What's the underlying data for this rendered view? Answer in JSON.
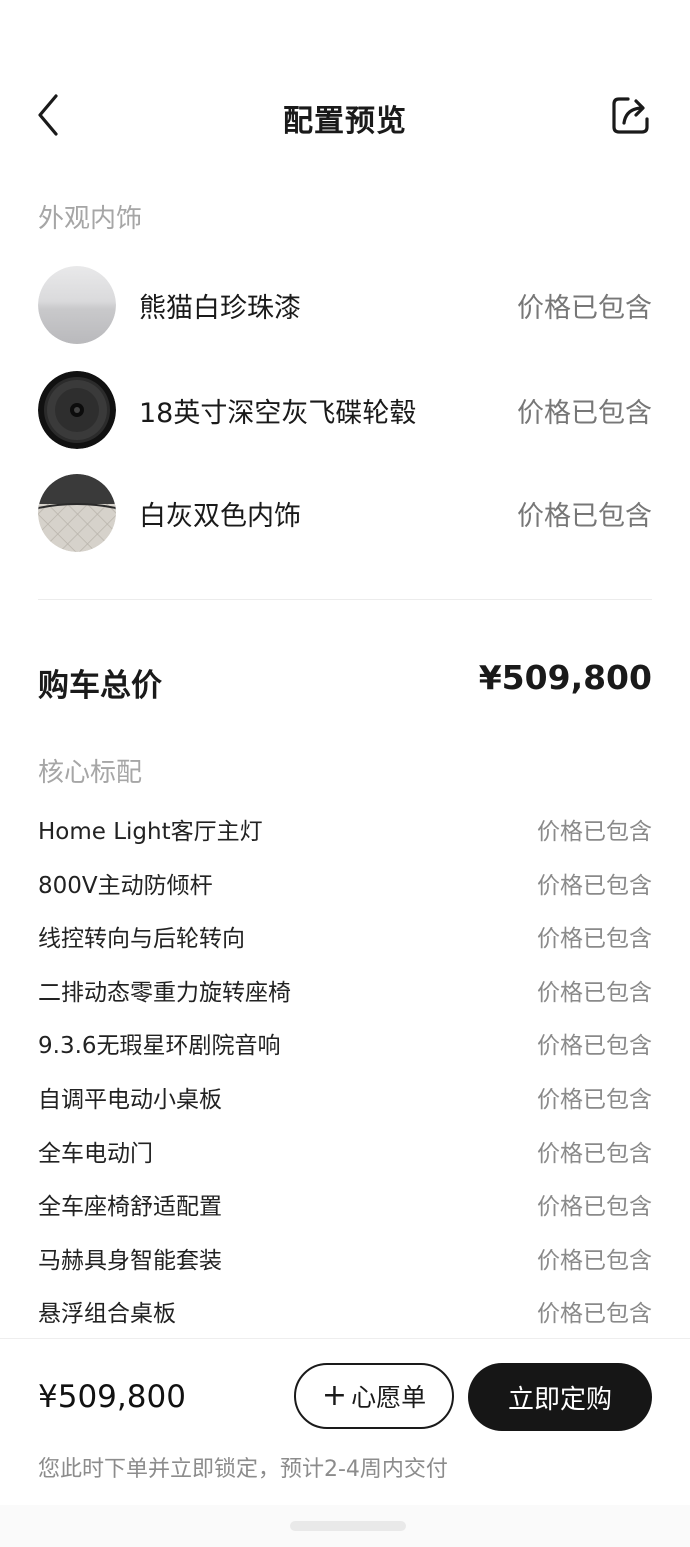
{
  "header": {
    "title": "配置预览",
    "back_icon": "chevron-left-icon",
    "share_icon": "share-icon"
  },
  "appearance": {
    "section_label": "外观内饰",
    "options": [
      {
        "name": "熊猫白珍珠漆",
        "price": "价格已包含",
        "swatch": "paint-swatch",
        "color": "#d4d4d6"
      },
      {
        "name": "18英寸深空灰飞碟轮毂",
        "price": "价格已包含",
        "swatch": "wheel-swatch",
        "color": "#1b1b1b"
      },
      {
        "name": "白灰双色内饰",
        "price": "价格已包含",
        "swatch": "interior-swatch",
        "color": "#cfcbc4"
      }
    ]
  },
  "total": {
    "label": "购车总价",
    "value": "¥509,800"
  },
  "core_features": {
    "section_label": "核心标配",
    "items": [
      {
        "name": "Home Light客厅主灯",
        "price": "价格已包含"
      },
      {
        "name": "800V主动防倾杆",
        "price": "价格已包含"
      },
      {
        "name": "线控转向与后轮转向",
        "price": "价格已包含"
      },
      {
        "name": "二排动态零重力旋转座椅",
        "price": "价格已包含"
      },
      {
        "name": "9.3.6无瑕星环剧院音响",
        "price": "价格已包含"
      },
      {
        "name": "自调平电动小桌板",
        "price": "价格已包含"
      },
      {
        "name": "全车电动门",
        "price": "价格已包含"
      },
      {
        "name": "全车座椅舒适配置",
        "price": "价格已包含"
      },
      {
        "name": "马赫具身智能套装",
        "price": "价格已包含"
      },
      {
        "name": "悬浮组合桌板",
        "price": "价格已包含"
      }
    ]
  },
  "bottom": {
    "price": "¥509,800",
    "wishlist_plus": "+",
    "wishlist_label": "心愿单",
    "buy_label": "立即定购",
    "delivery_note": "您此时下单并立即锁定，预计2-4周内交付"
  },
  "colors": {
    "accent": "#161616",
    "muted_text": "#a6a6a6"
  }
}
